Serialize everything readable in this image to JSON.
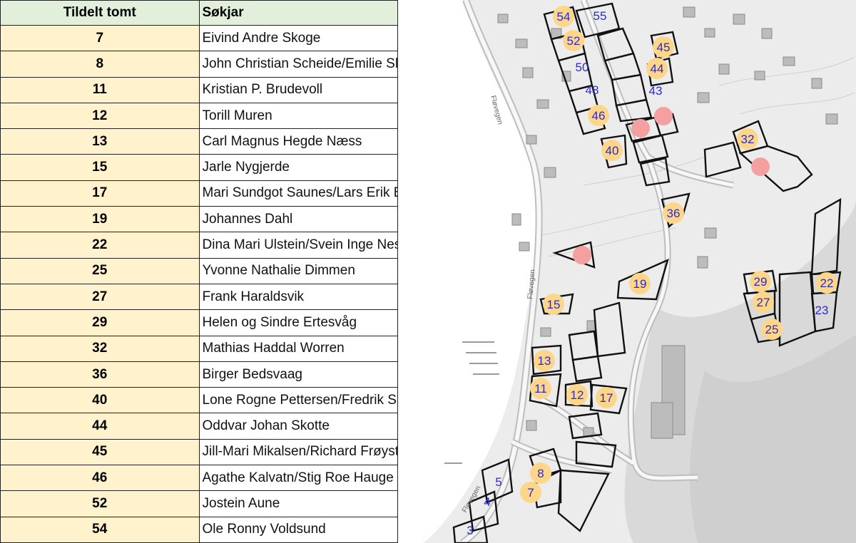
{
  "table": {
    "headers": [
      "Tildelt tomt",
      "Søkjar"
    ],
    "rows": [
      [
        "7",
        "Eivind Andre Skoge"
      ],
      [
        "8",
        "John Christian Scheide/Emilie Slotterøy Almli"
      ],
      [
        "11",
        "Kristian P. Brudevoll"
      ],
      [
        "12",
        "Torill Muren"
      ],
      [
        "13",
        "Carl Magnus Hegde Næss"
      ],
      [
        "15",
        "Jarle Nygjerde"
      ],
      [
        "17",
        "Mari Sundgot Saunes/Lars Erik Bøe"
      ],
      [
        "19",
        "Johannes Dahl"
      ],
      [
        "22",
        "Dina Mari Ulstein/Svein Inge Nesset"
      ],
      [
        "25",
        "Yvonne Nathalie Dimmen"
      ],
      [
        "27",
        "Frank Haraldsvik"
      ],
      [
        "29",
        "Helen og Sindre Ertesvåg"
      ],
      [
        "32",
        "Mathias Haddal Worren"
      ],
      [
        "36",
        "Birger Bedsvaag"
      ],
      [
        "40",
        "Lone Rogne Pettersen/Fredrik Sundal"
      ],
      [
        "44",
        "Oddvar Johan Skotte"
      ],
      [
        "45",
        "Jill-Mari Mikalsen/Richard Frøystad"
      ],
      [
        "46",
        "Agathe Kalvatn/Stig Roe Hauge"
      ],
      [
        "52",
        "Jostein Aune"
      ],
      [
        "54",
        "Ole Ronny Voldsund"
      ]
    ]
  },
  "map": {
    "colors": {
      "assigned_marker": "#fdd68a",
      "reserved_marker": "#f4a0a0",
      "plot_number": "#2a2ad0"
    },
    "assigned_plots": [
      "54",
      "52",
      "46",
      "45",
      "44",
      "40",
      "36",
      "32",
      "29",
      "27",
      "25",
      "22",
      "19",
      "15",
      "13",
      "12",
      "11",
      "17",
      "8",
      "7"
    ],
    "unassigned_plots": [
      "55",
      "50",
      "48",
      "43",
      "23",
      "5",
      "4",
      "3"
    ],
    "road_labels": [
      "Fløvegen",
      "Fløvegen",
      "Fløvegen"
    ]
  }
}
